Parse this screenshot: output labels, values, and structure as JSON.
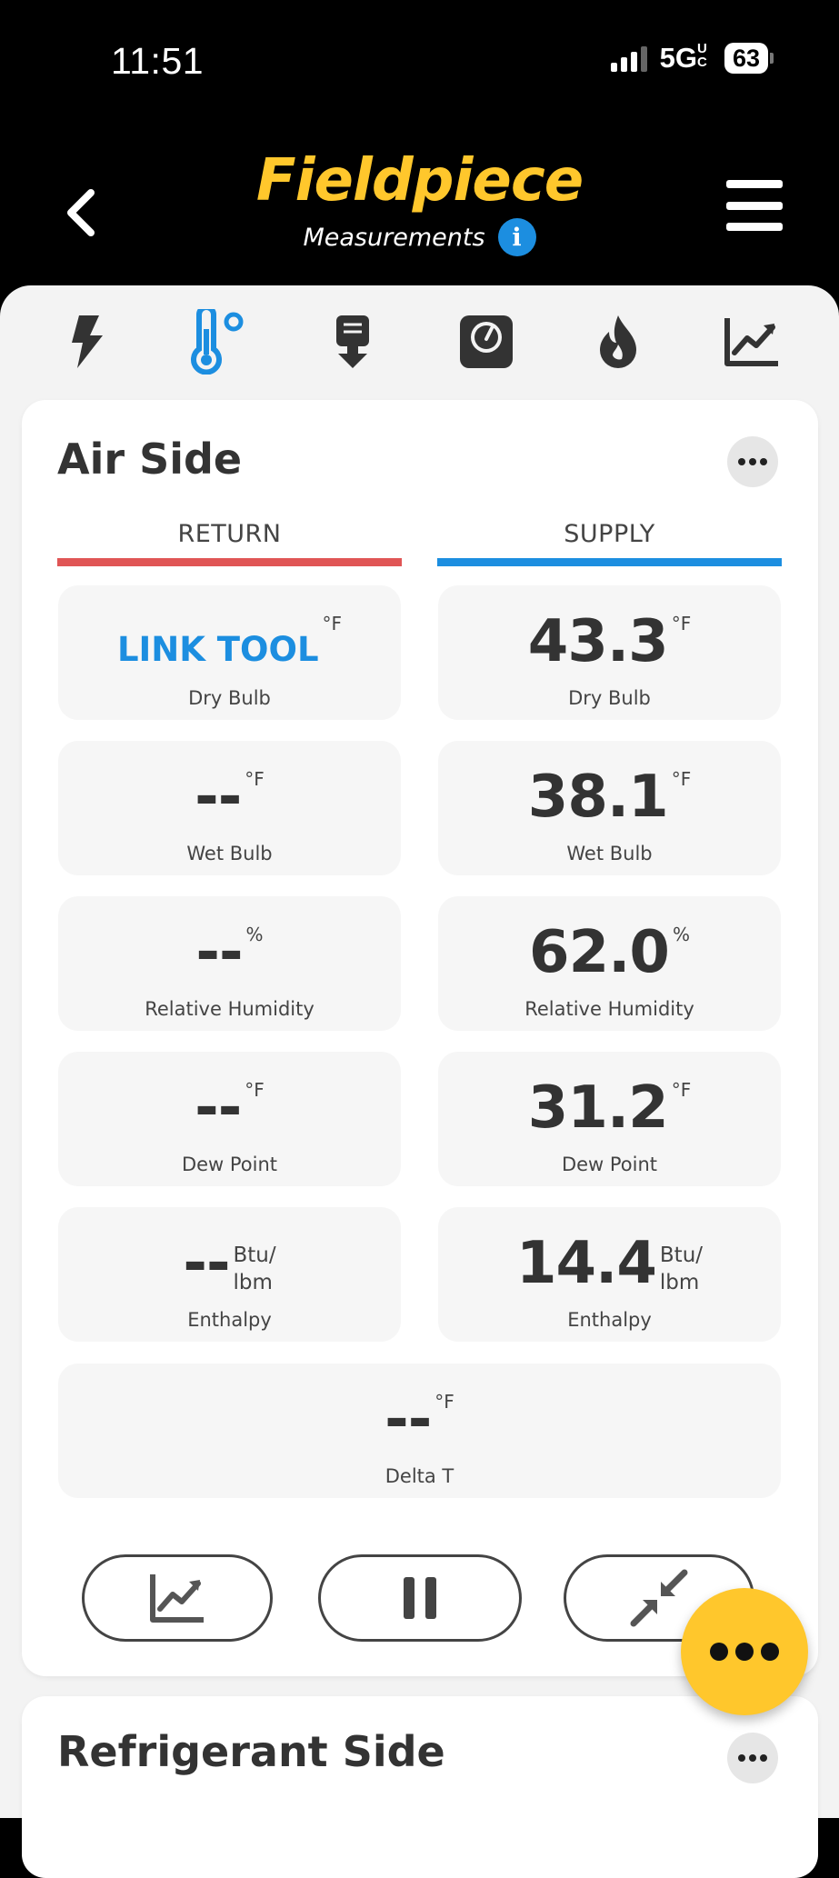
{
  "status_bar": {
    "time": "11:51",
    "network": "5G",
    "network_suffix": "UC",
    "battery": "63"
  },
  "header": {
    "brand": "Fieldpiece",
    "subtitle": "Measurements",
    "info_icon": "info-icon",
    "back_icon": "chevron-left-icon",
    "menu_icon": "hamburger-menu-icon"
  },
  "nav_icons": [
    {
      "name": "electrical",
      "icon": "lightning-bolt-icon"
    },
    {
      "name": "temperature",
      "icon": "thermometer-icon",
      "active": true
    },
    {
      "name": "probe",
      "icon": "probe-download-icon"
    },
    {
      "name": "gauge",
      "icon": "pressure-gauge-icon"
    },
    {
      "name": "combustion",
      "icon": "flame-icon"
    },
    {
      "name": "graph",
      "icon": "trend-chart-icon"
    }
  ],
  "colors": {
    "accent_yellow": "#FFC72C",
    "active_blue": "#1C8EE0",
    "return_red": "#E05555",
    "supply_blue": "#1C8EE0"
  },
  "air_side": {
    "title": "Air Side",
    "return_label": "RETURN",
    "supply_label": "SUPPLY",
    "return": [
      {
        "value": "LINK TOOL",
        "unit": "°F",
        "label": "Dry Bulb"
      },
      {
        "value": "--",
        "unit": "°F",
        "label": "Wet Bulb"
      },
      {
        "value": "--",
        "unit": "%",
        "label": "Relative Humidity"
      },
      {
        "value": "--",
        "unit": "°F",
        "label": "Dew Point"
      },
      {
        "value": "--",
        "unit_line1": "Btu/",
        "unit_line2": "lbm",
        "label": "Enthalpy"
      }
    ],
    "supply": [
      {
        "value": "43.3",
        "unit": "°F",
        "label": "Dry Bulb"
      },
      {
        "value": "38.1",
        "unit": "°F",
        "label": "Wet Bulb"
      },
      {
        "value": "62.0",
        "unit": "%",
        "label": "Relative Humidity"
      },
      {
        "value": "31.2",
        "unit": "°F",
        "label": "Dew Point"
      },
      {
        "value": "14.4",
        "unit_line1": "Btu/",
        "unit_line2": "lbm",
        "label": "Enthalpy"
      }
    ],
    "delta": {
      "value": "--",
      "unit": "°F",
      "label": "Delta T"
    },
    "controls": [
      {
        "name": "graph",
        "icon": "trend-chart-icon"
      },
      {
        "name": "pause",
        "icon": "pause-icon"
      },
      {
        "name": "collapse",
        "icon": "collapse-arrows-icon"
      }
    ]
  },
  "refrigerant_side": {
    "title": "Refrigerant Side"
  },
  "fab": {
    "icon": "more-horizontal-icon"
  }
}
